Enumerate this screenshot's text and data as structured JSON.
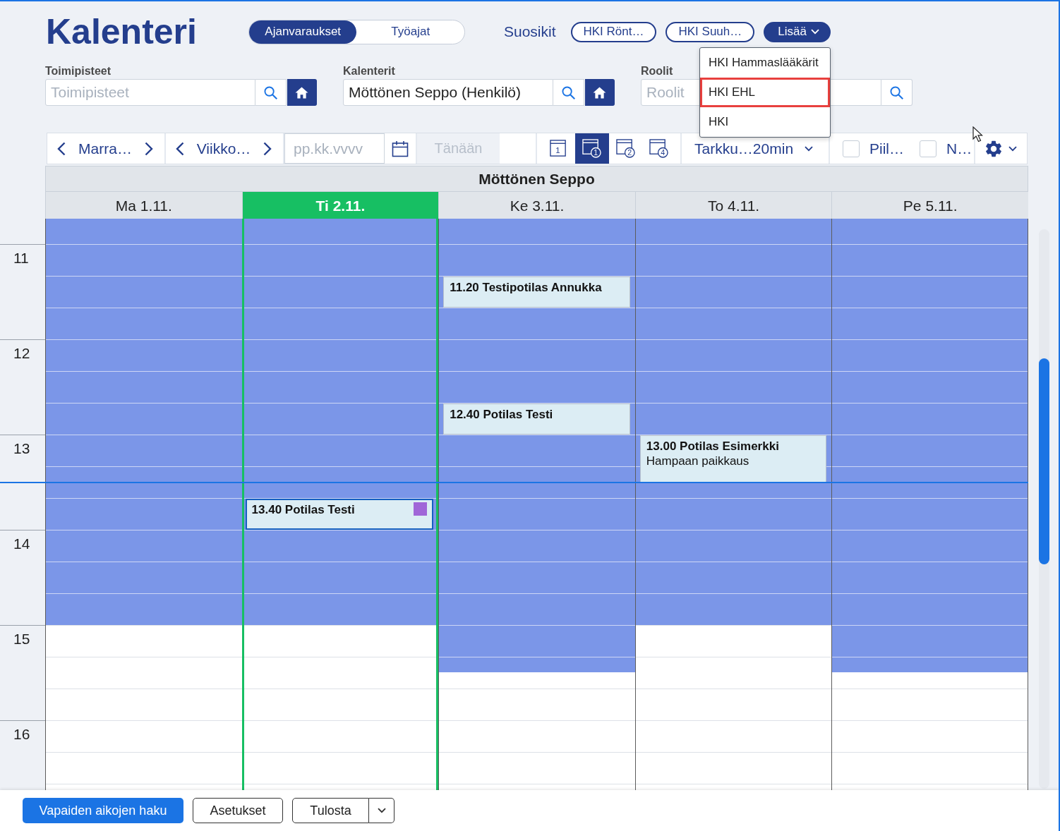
{
  "header": {
    "title": "Kalenteri",
    "mode_tabs": [
      {
        "label": "Ajanvaraukset",
        "selected": true
      },
      {
        "label": "Työajat",
        "selected": false
      }
    ],
    "favorites_label": "Suosikit",
    "favorites": [
      {
        "label": "HKI Rönt…"
      },
      {
        "label": "HKI Suuh…"
      }
    ],
    "more_button": {
      "label": "Lisää",
      "expanded": true
    },
    "more_menu": [
      {
        "label": "HKI Hammaslääkärit",
        "selected": false
      },
      {
        "label": "HKI EHL",
        "selected": true
      },
      {
        "label": "HKI",
        "selected": false
      }
    ]
  },
  "filters": [
    {
      "label": "Toimipisteet",
      "placeholder": "Toimipisteet",
      "home_button": true
    },
    {
      "label": "Kalenterit",
      "value": "Möttönen Seppo (Henkilö)",
      "home_button": true
    },
    {
      "label": "Roolit",
      "placeholder": "Roolit",
      "home_button": false
    }
  ],
  "toolbar": {
    "month": "Marra…",
    "week": "Viikko…",
    "date_placeholder": "pp.kk.vvvv",
    "today_button": {
      "label": "Tänään",
      "disabled": true
    },
    "views": [
      {
        "kind": "day",
        "number": "1",
        "selected": false
      },
      {
        "kind": "week",
        "number": "1",
        "selected": true
      },
      {
        "kind": "weeks",
        "number": "2",
        "selected": false
      },
      {
        "kind": "weeks",
        "number": "4",
        "selected": false
      }
    ],
    "resolution_label": "Tarkku…",
    "resolution": "20min",
    "checkboxes": [
      {
        "label": "Piil…",
        "checked": false
      },
      {
        "label": "N…",
        "checked": false
      }
    ]
  },
  "calendar": {
    "title": "Möttönen Seppo",
    "hours": [
      "11",
      "12",
      "13",
      "14",
      "15",
      "16"
    ],
    "current_time_line": true,
    "days": [
      {
        "label": "Ma 1.11.",
        "today": false,
        "available": {
          "level": 0.711
        }
      },
      {
        "label": "Ti 2.11.",
        "today": true,
        "available": {
          "level": 0.711
        },
        "events": [
          {
            "title": "13.40 Potilas Testi",
            "selected": true,
            "color": "#a066d8"
          }
        ]
      },
      {
        "label": "Ke 3.11.",
        "today": false,
        "available": {
          "level": 0.794
        },
        "events": [
          {
            "title": "11.20 Testipotilas Annukka",
            "selected": false
          },
          {
            "title": "12.40 Potilas Testi",
            "selected": false
          }
        ]
      },
      {
        "label": "To 4.11.",
        "today": false,
        "available": {
          "level": 0.711
        },
        "events": [
          {
            "title": "13.00 Potilas Esimerkki",
            "description": "Hampaan paikkaus",
            "selected": false
          }
        ]
      },
      {
        "label": "Pe 5.11.",
        "today": false,
        "available": {
          "level": 0.794
        }
      }
    ]
  },
  "footer_buttons": [
    {
      "label": "Vapaiden aikojen haku",
      "kind": "primary"
    },
    {
      "label": "Asetukset",
      "kind": "secondary"
    },
    {
      "label": "Tulosta",
      "kind": "split"
    }
  ]
}
